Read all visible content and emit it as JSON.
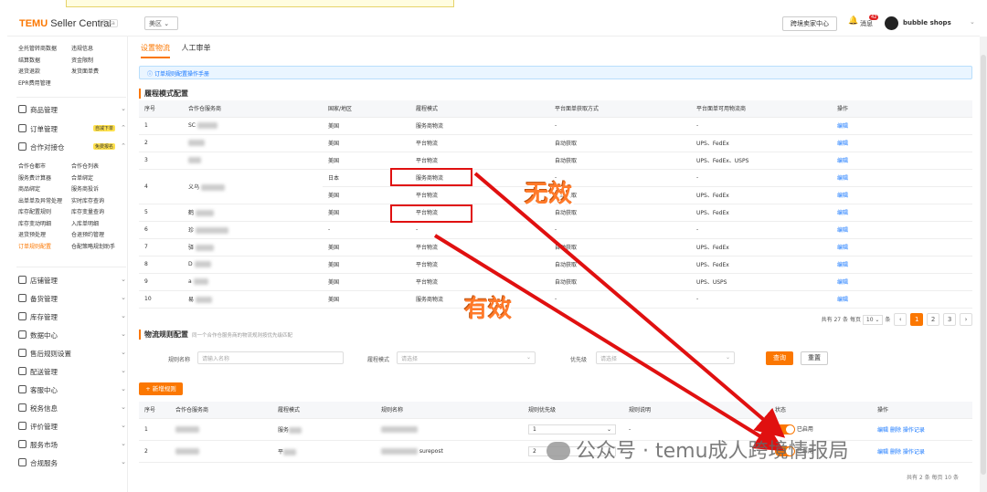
{
  "topbar": {
    "logo_brand": "TEMU",
    "logo_sub": "Seller Central",
    "beta": "Beta",
    "region": "美区",
    "cross_button": "跨境卖家中心",
    "messages_label": "消息",
    "messages_count": "42",
    "shop_name": "bubble shops"
  },
  "sidebar": {
    "top_links": [
      [
        "全托管转商数据",
        "违规信息"
      ],
      [
        "结算数据",
        "资金限制"
      ],
      [
        "退货退款",
        "发货面单费"
      ],
      [
        "EPR费用管理",
        ""
      ]
    ],
    "nav1": [
      {
        "label": "商品管理",
        "tag": ""
      },
      {
        "label": "订单管理",
        "tag": "自减下单"
      },
      {
        "label": "合作对接仓",
        "tag": "免费报名"
      }
    ],
    "sub_links": [
      [
        "合作仓都市",
        "合作仓列表"
      ],
      [
        "服务费计算器",
        "合单绑定"
      ],
      [
        "商品绑定",
        "服务商投诉"
      ],
      [
        "出单单及异常处理",
        "实时库存查询"
      ],
      [
        "库存配置规则",
        "库存变量查询"
      ],
      [
        "库存变动明细",
        "入库单明细"
      ],
      [
        "退货预处理",
        "仓退预约管理"
      ],
      [
        "订单规则配置",
        "仓配策略规划助手"
      ]
    ],
    "nav2": [
      {
        "label": "店铺管理"
      },
      {
        "label": "备货管理"
      },
      {
        "label": "库存管理"
      },
      {
        "label": "数据中心"
      },
      {
        "label": "售后规则设置"
      },
      {
        "label": "配送管理"
      },
      {
        "label": "客服中心"
      },
      {
        "label": "税务信息"
      },
      {
        "label": "评价管理"
      },
      {
        "label": "服务市场"
      },
      {
        "label": "合规服务"
      }
    ]
  },
  "tabs": [
    "设置物流",
    "人工审单"
  ],
  "info_text": "订单规则配置操作手册",
  "section1": {
    "title": "履程模式配置",
    "headers": [
      "序号",
      "合作仓服务商",
      "国家/地区",
      "履程模式",
      "平台面单获取方式",
      "平台面单可用物流商",
      "操作"
    ],
    "rows": [
      {
        "no": "1",
        "provider": "SC",
        "country": "美国",
        "mode": "服务商物流",
        "fetch": "-",
        "carriers": "-",
        "op": "编辑"
      },
      {
        "no": "2",
        "provider": "",
        "country": "美国",
        "mode": "平台物流",
        "fetch": "自动获取",
        "carriers": "UPS、FedEx",
        "op": "编辑"
      },
      {
        "no": "3",
        "provider": "",
        "country": "美国",
        "mode": "平台物流",
        "fetch": "自动获取",
        "carriers": "UPS、FedEx、USPS",
        "op": "编辑"
      },
      {
        "no": "4",
        "provider": "义乌",
        "country": "日本",
        "mode": "服务商物流",
        "fetch": "-",
        "carriers": "-",
        "op": "编辑",
        "country2": "美国",
        "mode2": "平台物流",
        "fetch2": "自动获取",
        "carriers2": "UPS、FedEx",
        "op2": "编辑"
      },
      {
        "no": "5",
        "provider": "鹤",
        "country": "美国",
        "mode": "平台物流",
        "fetch": "自动获取",
        "carriers": "UPS、FedEx",
        "op": "编辑"
      },
      {
        "no": "6",
        "provider": "珍",
        "country": "-",
        "mode": "-",
        "fetch": "-",
        "carriers": "-",
        "op": "编辑"
      },
      {
        "no": "7",
        "provider": "驿",
        "country": "美国",
        "mode": "平台物流",
        "fetch": "自动获取",
        "carriers": "UPS、FedEx",
        "op": "编辑"
      },
      {
        "no": "8",
        "provider": "D",
        "country": "美国",
        "mode": "平台物流",
        "fetch": "自动获取",
        "carriers": "UPS、FedEx",
        "op": "编辑"
      },
      {
        "no": "9",
        "provider": "a",
        "country": "美国",
        "mode": "平台物流",
        "fetch": "自动获取",
        "carriers": "UPS、USPS",
        "op": "编辑"
      },
      {
        "no": "10",
        "provider": "易",
        "country": "美国",
        "mode": "服务商物流",
        "fetch": "-",
        "carriers": "-",
        "op": "编辑"
      }
    ],
    "pager_total": "共有 27 条",
    "pager_per": "每页",
    "pager_size": "10",
    "pager_unit": "条",
    "pages": [
      "1",
      "2",
      "3"
    ]
  },
  "section2": {
    "title": "物流规则配置",
    "hint": "同一个合作仓服务商的物流规则按优先级匹配",
    "filter_rule_label": "规则名称",
    "filter_rule_placeholder": "请输入名称",
    "filter_mode_label": "履程模式",
    "filter_mode_placeholder": "请选择",
    "filter_priority_label": "优先级",
    "filter_priority_placeholder": "请选择",
    "query": "查询",
    "reset": "重置",
    "add": "+ 新增规则",
    "headers": [
      "序号",
      "合作仓服务商",
      "履程模式",
      "规则名称",
      "规则优先级",
      "规则说明",
      "状态",
      "操作"
    ],
    "rows": [
      {
        "no": "1",
        "mode": "服务",
        "rule": "",
        "priority": "1",
        "desc": "-",
        "status": "已启用",
        "ops": [
          "编辑",
          "删除",
          "操作记录"
        ]
      },
      {
        "no": "2",
        "mode": "平",
        "rule": "surepost",
        "priority": "2",
        "desc": "-",
        "status": "已启用",
        "ops": [
          "编辑",
          "删除",
          "操作记录"
        ]
      }
    ],
    "footer": "共有 2 条  每页 10 条"
  },
  "annotations": {
    "invalid": "无效",
    "valid": "有效"
  },
  "watermark": "公众号 · temu成人跨境情报局"
}
